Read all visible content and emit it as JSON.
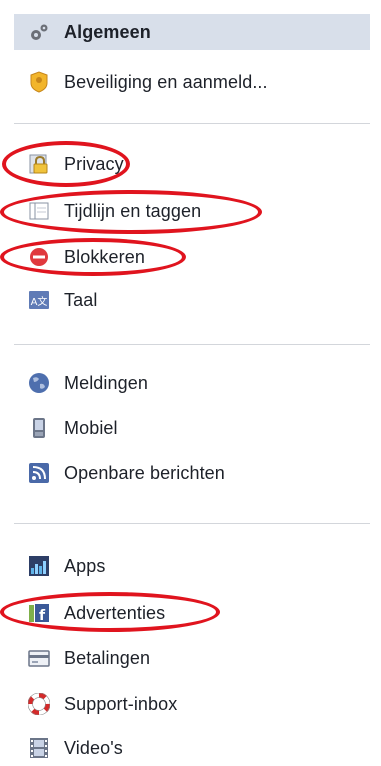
{
  "settings_nav": {
    "group1": [
      {
        "label": "Algemeen",
        "icon": "gears-icon",
        "selected": true
      },
      {
        "label": "Beveiliging en aanmeld...",
        "icon": "security-badge-icon"
      }
    ],
    "group2": [
      {
        "label": "Privacy",
        "icon": "lock-icon"
      },
      {
        "label": "Tijdlijn en taggen",
        "icon": "timeline-icon"
      },
      {
        "label": "Blokkeren",
        "icon": "block-icon"
      },
      {
        "label": "Taal",
        "icon": "language-icon"
      }
    ],
    "group3": [
      {
        "label": "Meldingen",
        "icon": "globe-icon"
      },
      {
        "label": "Mobiel",
        "icon": "mobile-phone-icon"
      },
      {
        "label": "Openbare berichten",
        "icon": "rss-icon"
      }
    ],
    "group4": [
      {
        "label": "Apps",
        "icon": "apps-icon"
      },
      {
        "label": "Advertenties",
        "icon": "ads-icon"
      },
      {
        "label": "Betalingen",
        "icon": "credit-card-icon"
      },
      {
        "label": "Support-inbox",
        "icon": "lifebuoy-icon"
      },
      {
        "label": "Video's",
        "icon": "film-icon"
      }
    ]
  },
  "colors": {
    "selected_background": "#d8dfea",
    "annotation_red": "#e0141e",
    "text": "#1d2129",
    "divider": "#d3d6db"
  }
}
